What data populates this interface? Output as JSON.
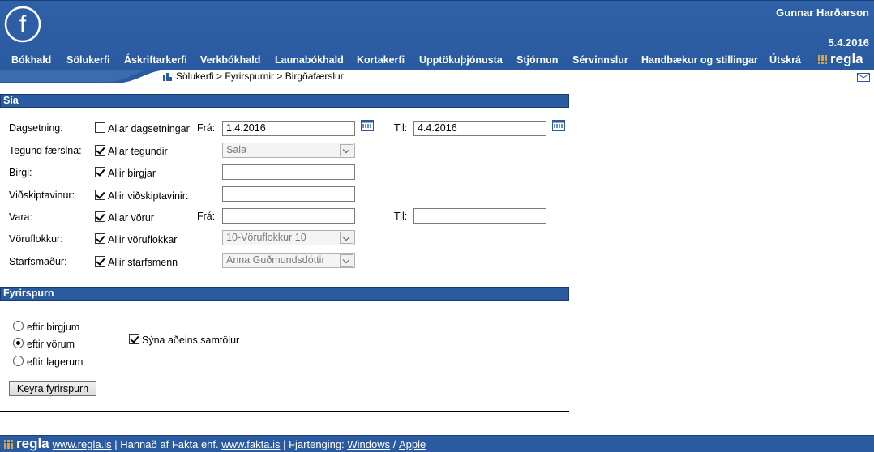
{
  "header": {
    "user_name": "Gunnar Harðarson",
    "date": "5.4.2016",
    "logo_letter": "f",
    "nav": [
      {
        "label": "Bókhald"
      },
      {
        "label": "Sölukerfi"
      },
      {
        "label": "Áskriftarkerfi"
      },
      {
        "label": "Verkbókhald"
      },
      {
        "label": "Launabókhald"
      },
      {
        "label": "Kortakerfi"
      },
      {
        "label": "Upptökuþjónusta"
      },
      {
        "label": "Stjórnun"
      },
      {
        "label": "Sérvinnslur"
      },
      {
        "label": "Handbækur og stillingar"
      },
      {
        "label": "Útskrá"
      }
    ],
    "brand": "regla"
  },
  "breadcrumb": "Sölukerfi > Fyrirspurnir > Birgðafærslur",
  "filter": {
    "title": "Sía",
    "rows": {
      "date": {
        "label": "Dagsetning:",
        "checkbox_label": "Allar dagsetningar",
        "checked": false,
        "from_label": "Frá:",
        "from_value": "1.4.2016",
        "to_label": "Til:",
        "to_value": "4.4.2016"
      },
      "type": {
        "label": "Tegund færslna:",
        "checkbox_label": "Allar tegundir",
        "checked": true,
        "select_value": "Sala"
      },
      "supplier": {
        "label": "Birgi:",
        "checkbox_label": "Allir birgjar",
        "checked": true,
        "value": ""
      },
      "customer": {
        "label": "Viðskiptavinur:",
        "checkbox_label": "Allir viðskiptavinir:",
        "checked": true,
        "value": ""
      },
      "item": {
        "label": "Vara:",
        "checkbox_label": "Allar vörur",
        "checked": true,
        "from_label": "Frá:",
        "from_value": "",
        "to_label": "Til:",
        "to_value": ""
      },
      "item_group": {
        "label": "Vöruflokkur:",
        "checkbox_label": "Allir vöruflokkar",
        "checked": true,
        "select_value": "10-Vöruflokkur 10"
      },
      "employee": {
        "label": "Starfsmaður:",
        "checkbox_label": "Allir starfsmenn",
        "checked": true,
        "select_value": "Anna Guðmundsdóttir"
      }
    }
  },
  "query": {
    "title": "Fyrirspurn",
    "options": [
      {
        "label": "eftir birgjum",
        "selected": false
      },
      {
        "label": "eftir vörum",
        "selected": true
      },
      {
        "label": "eftir lagerum",
        "selected": false
      }
    ],
    "totals_only_label": "Sýna aðeins samtölur",
    "totals_only_checked": true,
    "run_button_label": "Keyra fyrirspurn"
  },
  "footer": {
    "brand": "regla",
    "site_link": "www.regla.is",
    "designed_by": " | Hannað af Fakta ehf. ",
    "fakta_link": "www.fakta.is",
    "remote_label": " | Fjartenging: ",
    "windows_link": "Windows",
    "separator": " / ",
    "apple_link": "Apple"
  },
  "colors": {
    "header_blue": "#2a5aa0",
    "brand_orange": "#e0a040"
  }
}
